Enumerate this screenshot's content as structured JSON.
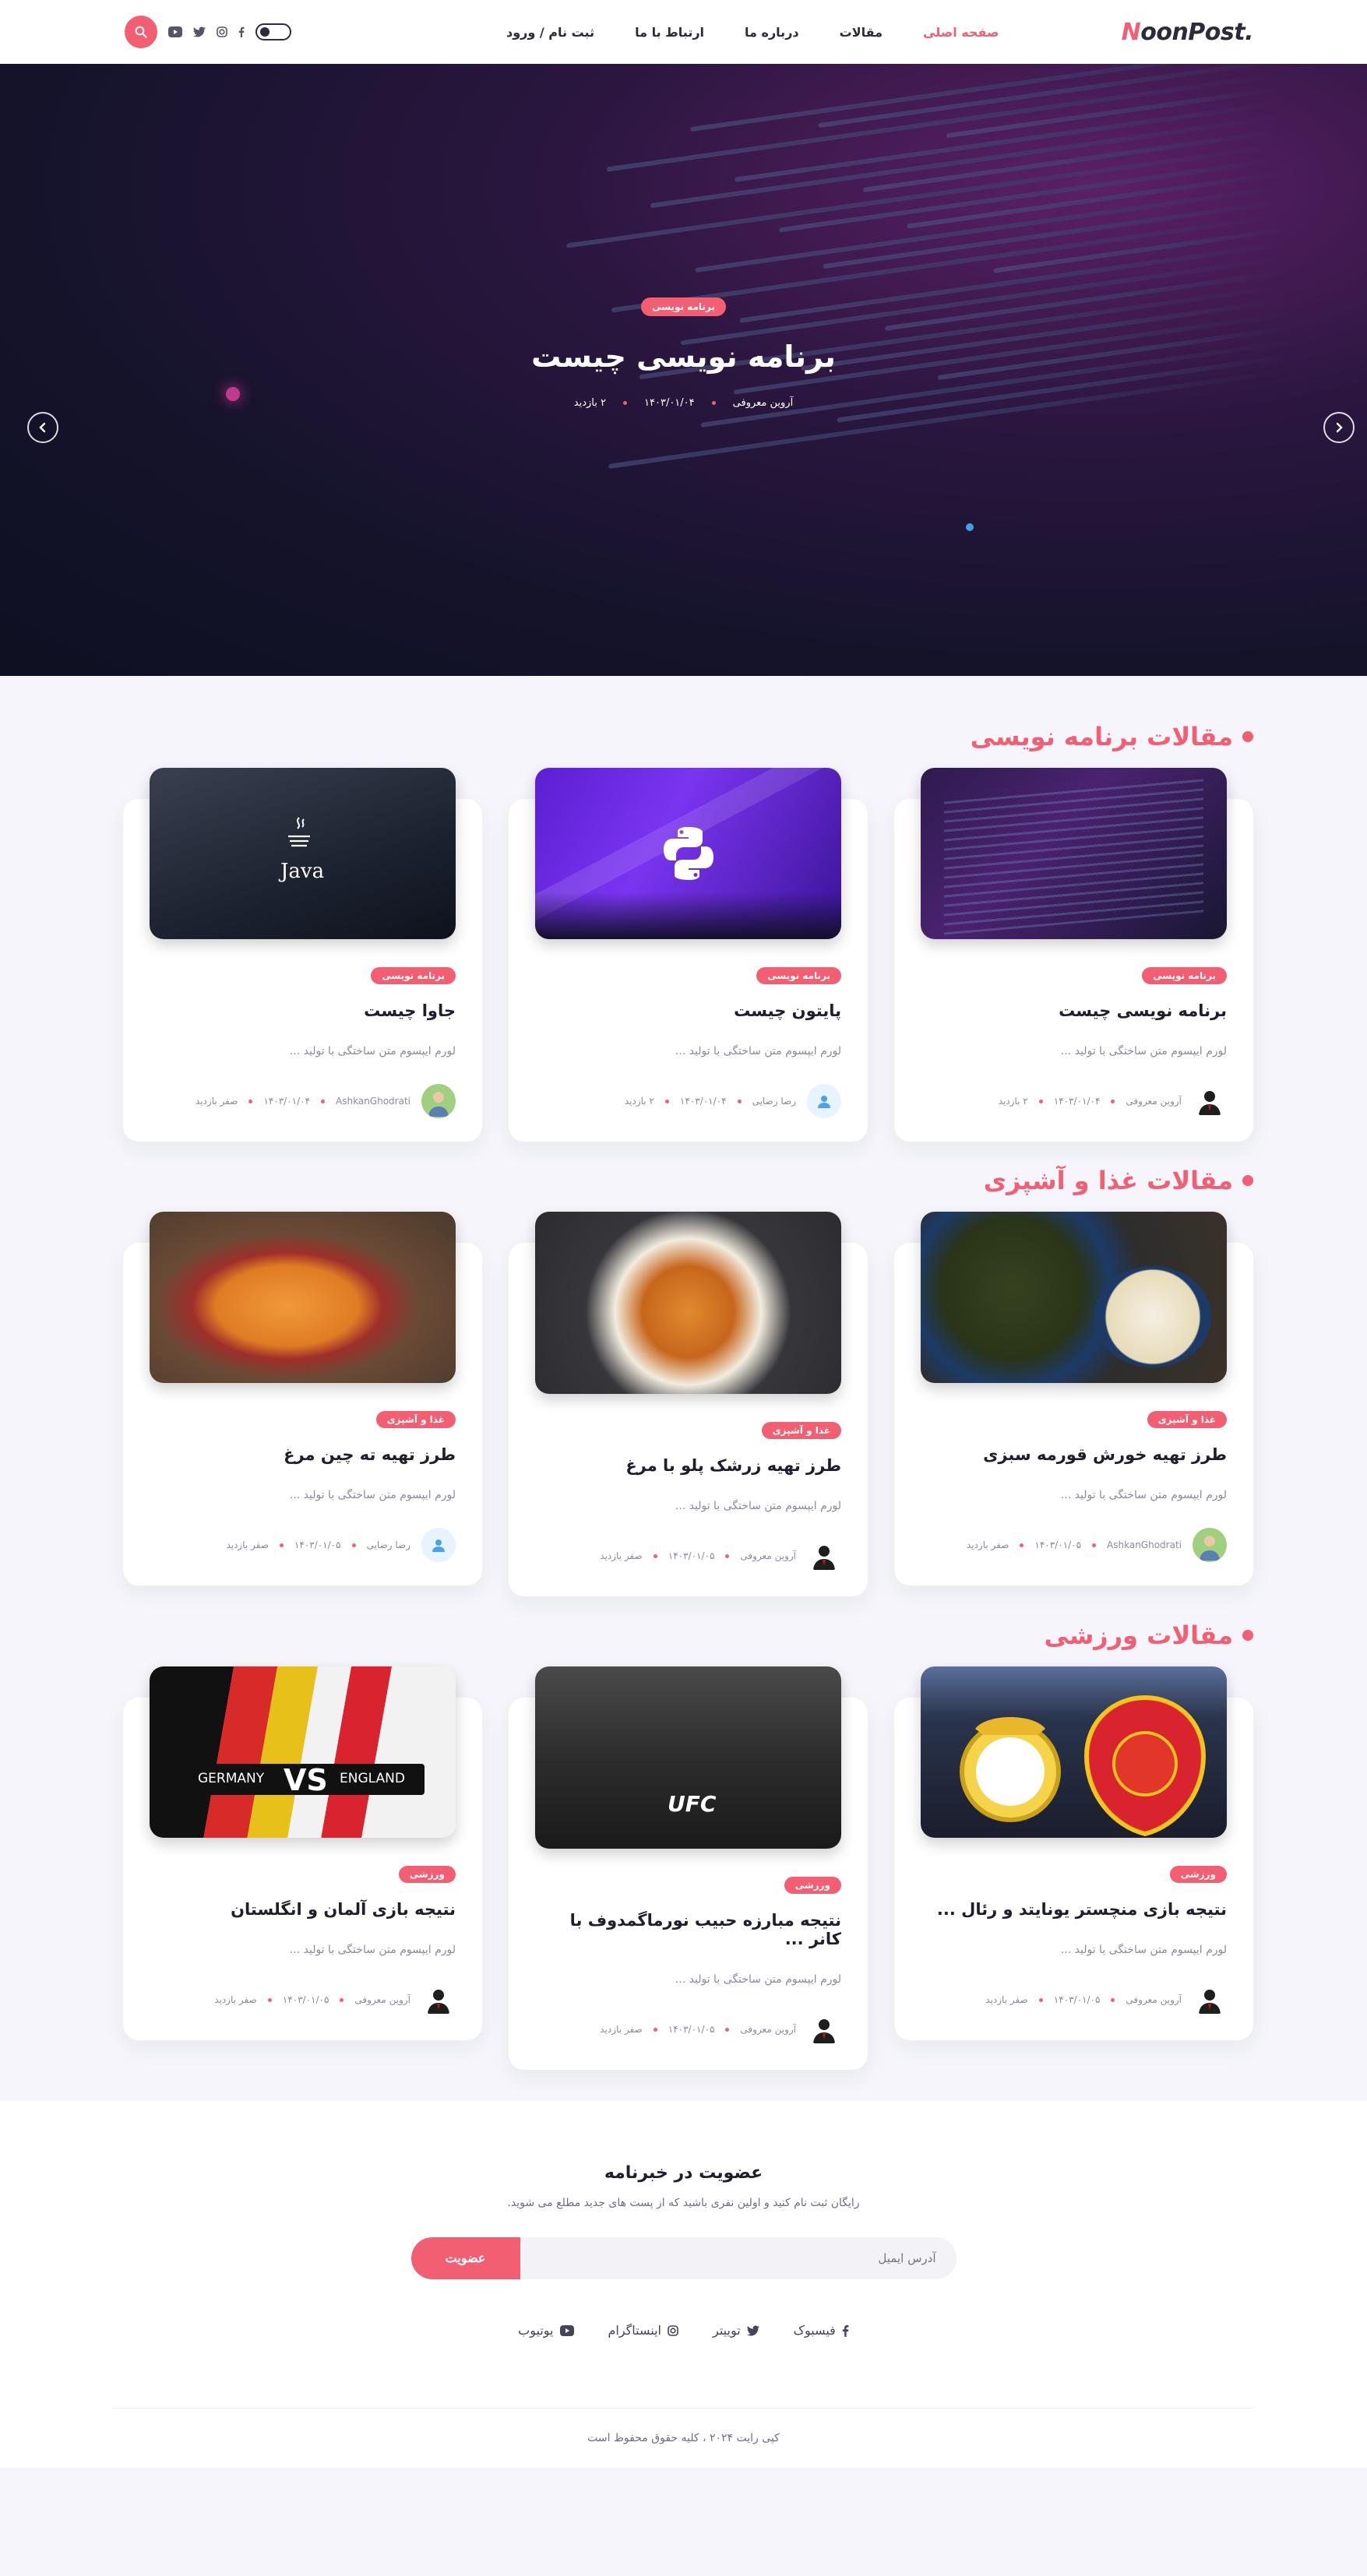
{
  "header": {
    "logo_first": "N",
    "logo_rest": "oonPost.",
    "nav": [
      {
        "label": "صفحه اصلی",
        "active": true
      },
      {
        "label": "مقالات",
        "active": false
      },
      {
        "label": "درباره ما",
        "active": false
      },
      {
        "label": "ارتباط با ما",
        "active": false
      },
      {
        "label": "ثبت نام / ورود",
        "active": false
      }
    ]
  },
  "hero": {
    "badge": "برنامه نویسی",
    "title": "برنامه نویسی چیست",
    "author": "آروین معروفی",
    "date": "۱۴۰۳/۰۱/۰۴",
    "views": "۲ بازدید"
  },
  "sections": [
    {
      "title": "مقالات برنامه نویسی",
      "cards": [
        {
          "cat": "برنامه نویسی",
          "title": "برنامه نویسی چیست",
          "excerpt": "لورم ایپسوم متن ساختگی با تولید ...",
          "author": "آروین معروفی",
          "date": "۱۴۰۳/۰۱/۰۴",
          "views": "۲ بازدید"
        },
        {
          "cat": "برنامه نویسی",
          "title": "پایتون چیست",
          "excerpt": "لورم ایپسوم متن ساختگی با تولید ...",
          "author": "رضا رضایی",
          "date": "۱۴۰۳/۰۱/۰۴",
          "views": "۲ بازدید"
        },
        {
          "cat": "برنامه نویسی",
          "title": "جاوا چیست",
          "excerpt": "لورم ایپسوم متن ساختگی با تولید ...",
          "author": "AshkanGhodrati",
          "date": "۱۴۰۳/۰۱/۰۴",
          "views": "صفر بازدید",
          "thumb_label": "Java"
        }
      ]
    },
    {
      "title": "مقالات غذا و آشپزی",
      "cards": [
        {
          "cat": "غذا و آشپزی",
          "title": "طرز تهیه خورش قورمه سبزی",
          "excerpt": "لورم ایپسوم متن ساختگی با تولید ...",
          "author": "AshkanGhodrati",
          "date": "۱۴۰۳/۰۱/۰۵",
          "views": "صفر بازدید"
        },
        {
          "cat": "غذا و آشپزی",
          "title": "طرز تهیه زرشک پلو با مرغ",
          "excerpt": "لورم ایپسوم متن ساختگی با تولید ...",
          "author": "آروین معروفی",
          "date": "۱۴۰۳/۰۱/۰۵",
          "views": "صفر بازدید"
        },
        {
          "cat": "غذا و آشپزی",
          "title": "طرز تهیه ته چین مرغ",
          "excerpt": "لورم ایپسوم متن ساختگی با تولید ...",
          "author": "رضا رضایی",
          "date": "۱۴۰۳/۰۱/۰۵",
          "views": "صفر بازدید"
        }
      ]
    },
    {
      "title": "مقالات ورزشی",
      "cards": [
        {
          "cat": "ورزشی",
          "title": "نتیجه بازی منچستر یونایتد و رئال ...",
          "excerpt": "لورم ایپسوم متن ساختگی با تولید ...",
          "author": "آروین معروفی",
          "date": "۱۴۰۳/۰۱/۰۵",
          "views": "صفر بازدید"
        },
        {
          "cat": "ورزشی",
          "title": "نتیجه مبارزه حبیب نورماگمدوف با کانر ...",
          "excerpt": "لورم ایپسوم متن ساختگی با تولید ...",
          "author": "آروین معروفی",
          "date": "۱۴۰۳/۰۱/۰۵",
          "views": "صفر بازدید",
          "thumb_label": "UFC"
        },
        {
          "cat": "ورزشی",
          "title": "نتیجه بازی آلمان و انگلستان",
          "excerpt": "لورم ایپسوم متن ساختگی با تولید ...",
          "author": "آروین معروفی",
          "date": "۱۴۰۳/۰۱/۰۵",
          "views": "صفر بازدید",
          "thumb_left": "GERMANY",
          "thumb_vs": "VS",
          "thumb_right": "ENGLAND"
        }
      ]
    }
  ],
  "footer": {
    "nl_title": "عضویت در خبرنامه",
    "nl_sub": "رایگان ثبت نام کنید و اولین نفری باشید که از پست های جدید مطلع می شوید.",
    "email_placeholder": "آدرس ایمیل",
    "subscribe": "عضویت",
    "social": [
      "فیسبوک",
      "توییتر",
      "اینستاگرام",
      "یوتیوب"
    ],
    "copyright": "کپی رایت ۲۰۲۴ ، کلیه حقوق محفوظ است"
  },
  "colors": {
    "accent": "#f25f73",
    "text": "#1e1e2d",
    "bg": "#f5f5fb"
  }
}
